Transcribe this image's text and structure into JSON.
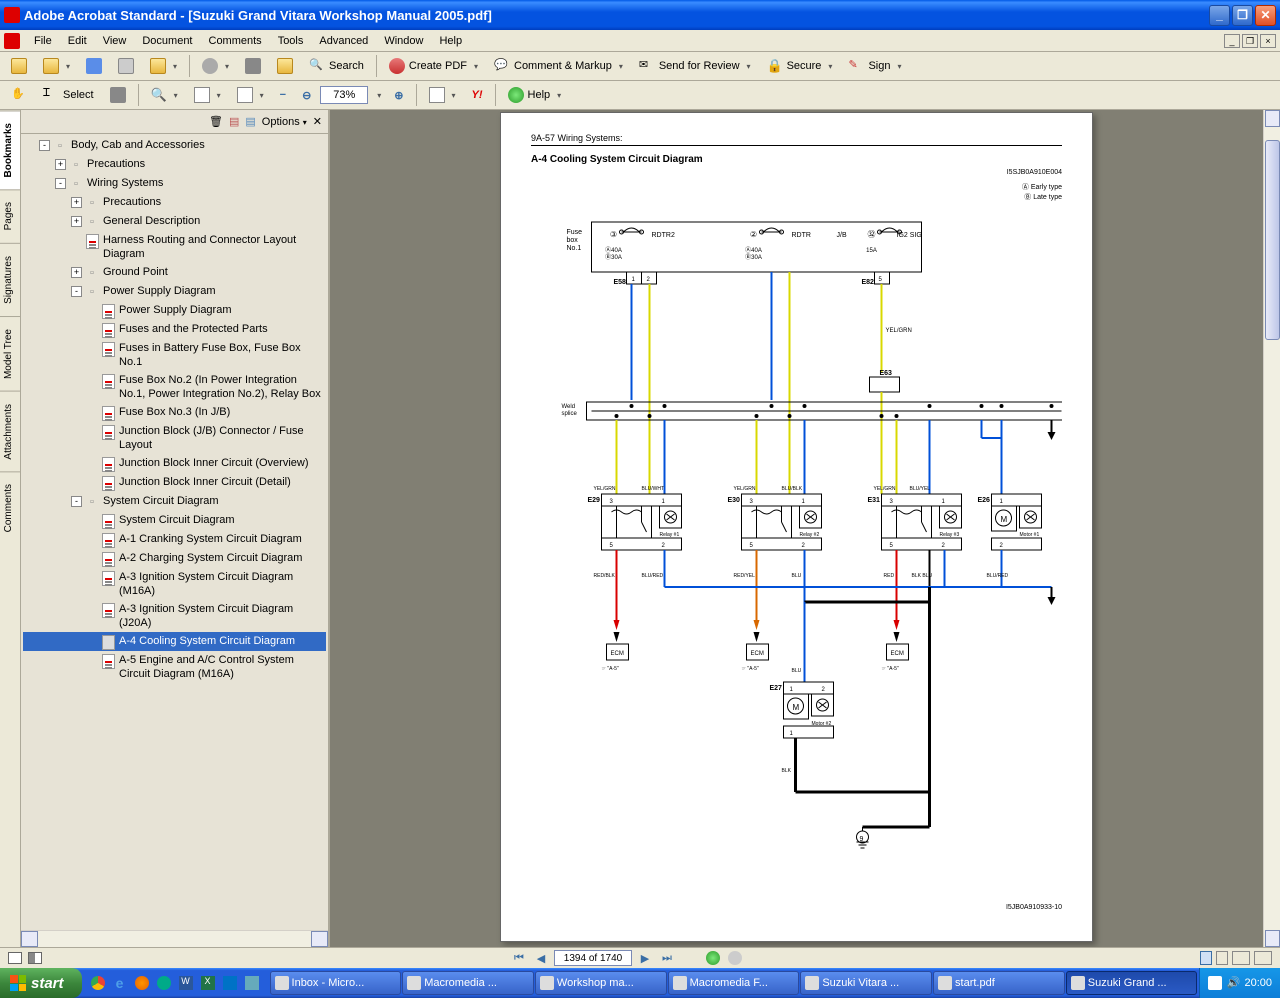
{
  "titlebar": {
    "title": "Adobe Acrobat Standard - [Suzuki Grand Vitara Workshop Manual 2005.pdf]"
  },
  "menubar": {
    "items": [
      "File",
      "Edit",
      "View",
      "Document",
      "Comments",
      "Tools",
      "Advanced",
      "Window",
      "Help"
    ]
  },
  "toolbar1": {
    "search": "Search",
    "createpdf": "Create PDF",
    "comment": "Comment & Markup",
    "send": "Send for Review",
    "secure": "Secure",
    "sign": "Sign"
  },
  "toolbar2": {
    "select": "Select",
    "zoom": "73%",
    "help": "Help"
  },
  "sidetabs": [
    "Bookmarks",
    "Pages",
    "Signatures",
    "Model Tree",
    "Attachments",
    "Comments"
  ],
  "bookmarks_toolbar": {
    "options": "Options"
  },
  "bookmarks": [
    {
      "indent": 1,
      "expand": "-",
      "icon": "folder",
      "label": "Body, Cab and Accessories"
    },
    {
      "indent": 2,
      "expand": "+",
      "icon": "folder",
      "label": "Precautions"
    },
    {
      "indent": 2,
      "expand": "-",
      "icon": "folder",
      "label": "Wiring Systems"
    },
    {
      "indent": 3,
      "expand": "+",
      "icon": "folder",
      "label": "Precautions"
    },
    {
      "indent": 3,
      "expand": "+",
      "icon": "folder",
      "label": "General Description"
    },
    {
      "indent": 3,
      "expand": "",
      "icon": "pdf",
      "label": "Harness Routing and Connector Layout Diagram"
    },
    {
      "indent": 3,
      "expand": "+",
      "icon": "folder",
      "label": "Ground Point"
    },
    {
      "indent": 3,
      "expand": "-",
      "icon": "folder",
      "label": "Power Supply Diagram"
    },
    {
      "indent": 4,
      "expand": "",
      "icon": "pdf",
      "label": "Power Supply Diagram"
    },
    {
      "indent": 4,
      "expand": "",
      "icon": "pdf",
      "label": "Fuses and the Protected Parts"
    },
    {
      "indent": 4,
      "expand": "",
      "icon": "pdf",
      "label": "Fuses in Battery Fuse Box, Fuse Box No.1"
    },
    {
      "indent": 4,
      "expand": "",
      "icon": "pdf",
      "label": "Fuse Box No.2 (In Power Integration No.1, Power Integration No.2), Relay Box"
    },
    {
      "indent": 4,
      "expand": "",
      "icon": "pdf",
      "label": "Fuse Box No.3 (In J/B)"
    },
    {
      "indent": 4,
      "expand": "",
      "icon": "pdf",
      "label": "Junction Block (J/B) Connector / Fuse Layout"
    },
    {
      "indent": 4,
      "expand": "",
      "icon": "pdf",
      "label": "Junction Block Inner Circuit (Overview)"
    },
    {
      "indent": 4,
      "expand": "",
      "icon": "pdf",
      "label": "Junction Block Inner Circuit (Detail)"
    },
    {
      "indent": 3,
      "expand": "-",
      "icon": "folder",
      "label": "System Circuit Diagram"
    },
    {
      "indent": 4,
      "expand": "",
      "icon": "pdf",
      "label": "System Circuit Diagram"
    },
    {
      "indent": 4,
      "expand": "",
      "icon": "pdf",
      "label": "A-1 Cranking System Circuit Diagram"
    },
    {
      "indent": 4,
      "expand": "",
      "icon": "pdf",
      "label": "A-2 Charging System Circuit Diagram"
    },
    {
      "indent": 4,
      "expand": "",
      "icon": "pdf",
      "label": "A-3 Ignition System Circuit Diagram (M16A)"
    },
    {
      "indent": 4,
      "expand": "",
      "icon": "pdf",
      "label": "A-3 Ignition System Circuit Diagram (J20A)"
    },
    {
      "indent": 4,
      "expand": "",
      "icon": "pdf-grey",
      "label": "A-4 Cooling System Circuit Diagram",
      "selected": true
    },
    {
      "indent": 4,
      "expand": "",
      "icon": "pdf",
      "label": "A-5 Engine and A/C Control System Circuit Diagram (M16A)"
    }
  ],
  "pdf": {
    "header": "9A-57   Wiring Systems:",
    "title": "A-4 Cooling System Circuit Diagram",
    "code_top": "I5SJB0A910E004",
    "legend_a": "Ⓐ Early type",
    "legend_b": "Ⓑ Late type",
    "footer": "I5JB0A910933-10",
    "labels": {
      "fusebox": "Fuse\nbox\nNo.1",
      "weld": "Weld\nsplice",
      "rdtr2": "RDTR2",
      "rdtr": "RDTR",
      "jb": "J/B",
      "ig2sig": "IG2 SIG",
      "fuse3": "③",
      "fuse2": "②",
      "fuse32": "㉜",
      "amp1": "Ⓐ40A\nⒷ30A",
      "amp2": "Ⓐ40A\nⒷ30A",
      "amp3": "15A",
      "e58": "E58",
      "e82": "E82",
      "e63": "E63",
      "e29": "E29",
      "e30": "E30",
      "e31": "E31",
      "e26": "E26",
      "e27": "E27",
      "relay1": "Relay #1",
      "relay2": "Relay #2",
      "relay3": "Relay #3",
      "motor1": "Motor #1",
      "motor2": "Motor #2",
      "ecm": "ECM",
      "a5": "☞ \"A-5\"",
      "yelgrn": "YEL/GRN",
      "bluwht": "BLU/WHT",
      "blublk": "BLU/BLK",
      "bluyel": "BLU/YEL",
      "redblk": "RED/BLK",
      "blured": "BLU/RED",
      "redyel": "RED/YEL",
      "blu": "BLU",
      "red": "RED",
      "blk": "BLK",
      "blkblu": "BLK BLU"
    }
  },
  "pagination": {
    "page_text": "1394 of 1740"
  },
  "taskbar": {
    "start": "start",
    "buttons": [
      {
        "label": "Inbox - Micro..."
      },
      {
        "label": "Macromedia ..."
      },
      {
        "label": "Workshop ma..."
      },
      {
        "label": "Macromedia F..."
      },
      {
        "label": "Suzuki Vitara ..."
      },
      {
        "label": "start.pdf"
      },
      {
        "label": "Suzuki Grand ...",
        "active": true
      }
    ],
    "time": "20:00"
  }
}
